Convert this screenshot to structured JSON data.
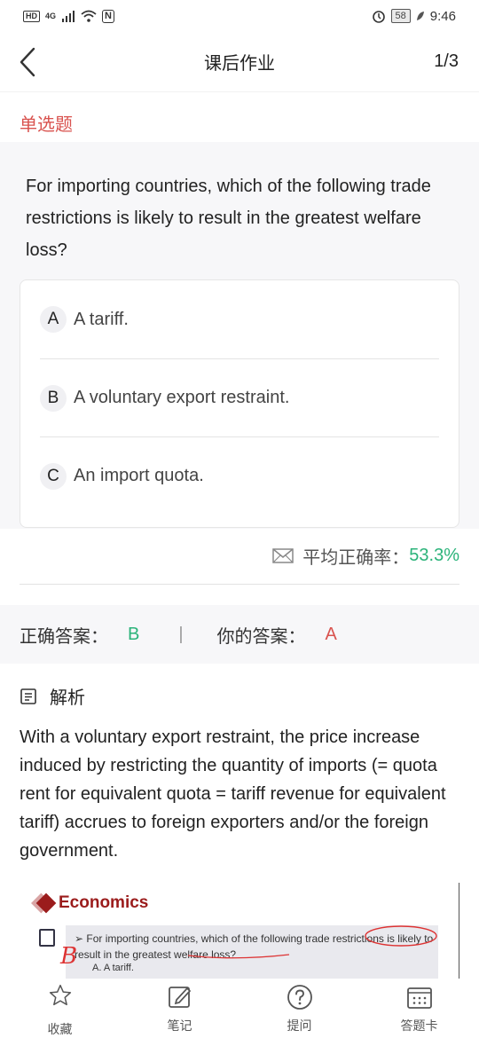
{
  "status_bar": {
    "hd": "HD",
    "net": "4G",
    "nfc": "N",
    "battery": "58",
    "time": "9:46"
  },
  "nav": {
    "title": "课后作业",
    "count": "1/3"
  },
  "question": {
    "type": "单选题",
    "text": "For importing countries, which of the following trade restrictions is likely to result in the greatest welfare loss?",
    "options": [
      {
        "letter": "A",
        "text": "A tariff."
      },
      {
        "letter": "B",
        "text": "A voluntary export restraint."
      },
      {
        "letter": "C",
        "text": "An import quota."
      }
    ]
  },
  "accuracy": {
    "label": "平均正确率：",
    "value": "53.3%"
  },
  "answers": {
    "correct_label": "正确答案：",
    "correct_value": "B",
    "separator": "|",
    "yours_label": "你的答案：",
    "yours_value": "A"
  },
  "analysis": {
    "heading": "解析",
    "text": "With a voluntary export restraint, the price increase induced by restricting the quantity of imports (= quota rent for equivalent quota = tariff revenue for equivalent tariff) accrues to foreign exporters and/or the foreign government.",
    "slide": {
      "logo": "Economics",
      "question": "➢  For importing countries, which of the following trade restrictions is likely to result in the greatest welfare loss?",
      "option": "A.  A tariff.",
      "handwritten": "B"
    }
  },
  "tabs": [
    {
      "label": "收藏",
      "icon": "star-icon"
    },
    {
      "label": "笔记",
      "icon": "edit-note-icon"
    },
    {
      "label": "提问",
      "icon": "question-icon"
    },
    {
      "label": "答题卡",
      "icon": "answer-card-icon"
    }
  ],
  "colors": {
    "accent_red": "#d9534f",
    "accent_green": "#2bb37a",
    "background_gray": "#f7f7f9"
  }
}
